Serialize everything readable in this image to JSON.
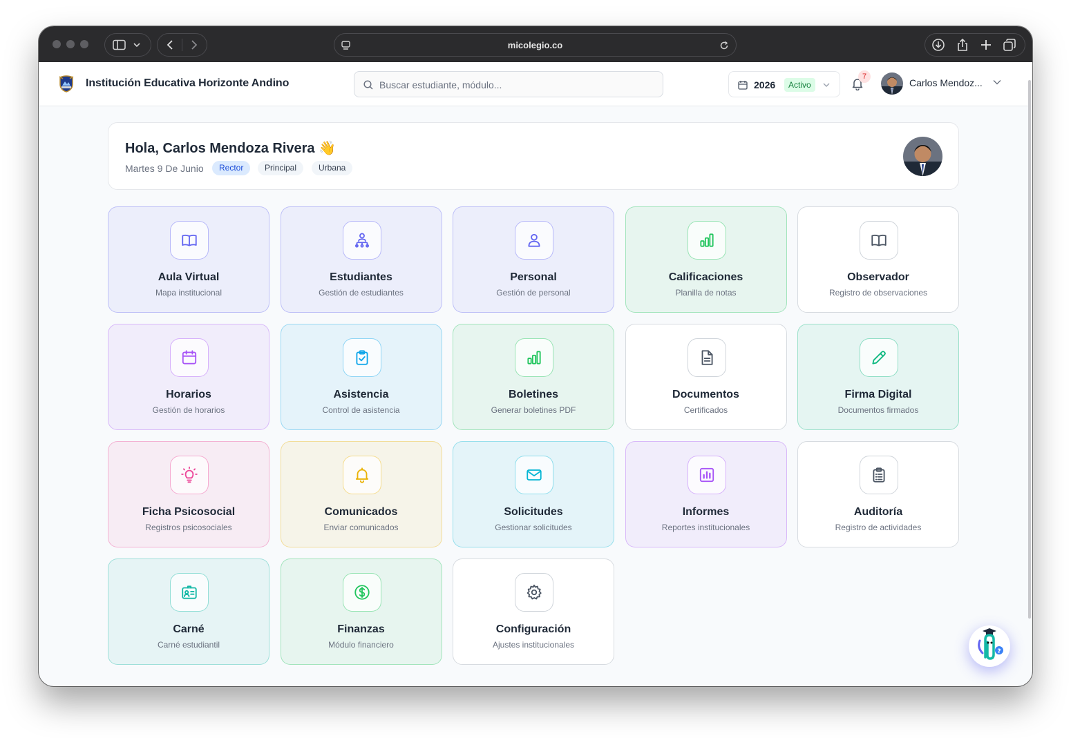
{
  "browser": {
    "url": "micolegio.co"
  },
  "header": {
    "school_name": "Institución Educativa Horizonte Andino",
    "search_placeholder": "Buscar estudiante, módulo...",
    "year": "2026",
    "year_status": "Activo",
    "notification_count": "7",
    "user_name": "Carlos Mendoz..."
  },
  "greeting": {
    "title": "Hola, Carlos Mendoza Rivera 👋",
    "date": "Martes 9 De Junio",
    "chips": [
      "Rector",
      "Principal",
      "Urbana"
    ]
  },
  "modules": [
    {
      "title": "Aula Virtual",
      "subtitle": "Mapa institucional",
      "icon": "book-open-icon",
      "color": "#6366f1"
    },
    {
      "title": "Estudiantes",
      "subtitle": "Gestión de estudiantes",
      "icon": "users-hierarchy-icon",
      "color": "#6366f1"
    },
    {
      "title": "Personal",
      "subtitle": "Gestión de personal",
      "icon": "user-icon",
      "color": "#6366f1"
    },
    {
      "title": "Calificaciones",
      "subtitle": "Planilla de notas",
      "icon": "bar-chart-icon",
      "color": "#22c55e"
    },
    {
      "title": "Observador",
      "subtitle": "Registro de observaciones",
      "icon": "book-open-icon",
      "color": "#6b7280"
    },
    {
      "title": "Horarios",
      "subtitle": "Gestión de horarios",
      "icon": "calendar-icon",
      "color": "#a855f7"
    },
    {
      "title": "Asistencia",
      "subtitle": "Control de asistencia",
      "icon": "clipboard-check-icon",
      "color": "#0ea5e9"
    },
    {
      "title": "Boletines",
      "subtitle": "Generar boletines PDF",
      "icon": "bar-chart-icon",
      "color": "#22c55e"
    },
    {
      "title": "Documentos",
      "subtitle": "Certificados",
      "icon": "file-text-icon",
      "color": "#6b7280"
    },
    {
      "title": "Firma Digital",
      "subtitle": "Documentos firmados",
      "icon": "pencil-icon",
      "color": "#10b981"
    },
    {
      "title": "Ficha Psicosocial",
      "subtitle": "Registros psicosociales",
      "icon": "lightbulb-icon",
      "color": "#ec4899"
    },
    {
      "title": "Comunicados",
      "subtitle": "Enviar comunicados",
      "icon": "bell-icon",
      "color": "#eab308"
    },
    {
      "title": "Solicitudes",
      "subtitle": "Gestionar solicitudes",
      "icon": "mail-icon",
      "color": "#06b6d4"
    },
    {
      "title": "Informes",
      "subtitle": "Reportes institucionales",
      "icon": "report-chart-icon",
      "color": "#a855f7"
    },
    {
      "title": "Auditoría",
      "subtitle": "Registro de actividades",
      "icon": "clipboard-list-icon",
      "color": "#6b7280"
    },
    {
      "title": "Carné",
      "subtitle": "Carné estudiantil",
      "icon": "id-card-icon",
      "color": "#14b8a6"
    },
    {
      "title": "Finanzas",
      "subtitle": "Módulo financiero",
      "icon": "dollar-circle-icon",
      "color": "#22c55e"
    },
    {
      "title": "Configuración",
      "subtitle": "Ajustes institucionales",
      "icon": "gear-icon",
      "color": "#6b7280"
    }
  ]
}
